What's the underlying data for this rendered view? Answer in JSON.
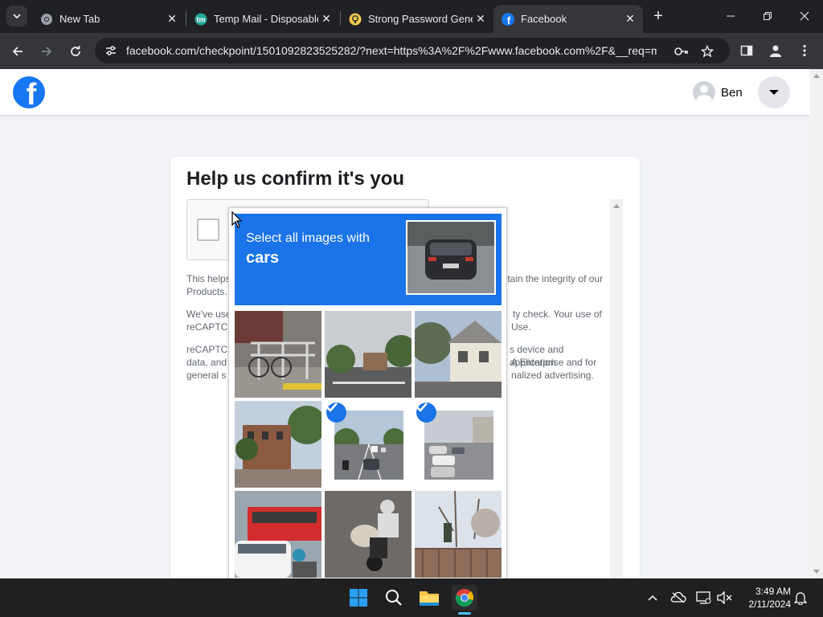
{
  "browser": {
    "tabs": [
      {
        "title": "New Tab",
        "icon": "chrome-icon",
        "active": false
      },
      {
        "title": "Temp Mail - Disposable",
        "icon": "tempmail-icon",
        "active": false
      },
      {
        "title": "Strong Password Generator",
        "icon": "password-generator-icon",
        "active": false
      },
      {
        "title": "Facebook",
        "icon": "facebook-icon",
        "active": true
      }
    ],
    "url": "facebook.com/checkpoint/1501092823525282/?next=https%3A%2F%2Fwww.facebook.com%2F&__req=m"
  },
  "facebook": {
    "user_name": "Ben",
    "heading": "Help us confirm it's you",
    "paragraphs": [
      {
        "left": "This helps",
        "right": "intain the integrity of our",
        "line2": "Products."
      },
      {
        "left": "We've use",
        "right": "ty check. Your use of",
        "line2_left": "reCAPTC",
        "line2_right": "Use."
      },
      {
        "left": "reCAPTC",
        "right": "s device and application",
        "line2_left": "data, and",
        "line2_right": "A Enterprise and for",
        "line3_left": "general s",
        "line3_right": "nalized advertising."
      }
    ]
  },
  "captcha": {
    "instruction": "Select all images with",
    "target": "cars",
    "tiles": [
      {
        "scene": "bicycle-railing",
        "selected": false
      },
      {
        "scene": "street-trees",
        "selected": false
      },
      {
        "scene": "house",
        "selected": false
      },
      {
        "scene": "brick-building-street",
        "selected": false
      },
      {
        "scene": "highway-cars",
        "selected": true
      },
      {
        "scene": "parking-lot",
        "selected": true
      },
      {
        "scene": "bus-car",
        "selected": false
      },
      {
        "scene": "scooter-rider",
        "selected": false
      },
      {
        "scene": "tree-fence",
        "selected": false
      }
    ]
  },
  "taskbar": {
    "time": "3:49 AM",
    "date": "2/11/2024"
  },
  "colors": {
    "facebook_blue": "#1877f2",
    "captcha_blue": "#1a73e8",
    "chrome_dark": "#202124",
    "chrome_toolbar": "#35363a"
  }
}
